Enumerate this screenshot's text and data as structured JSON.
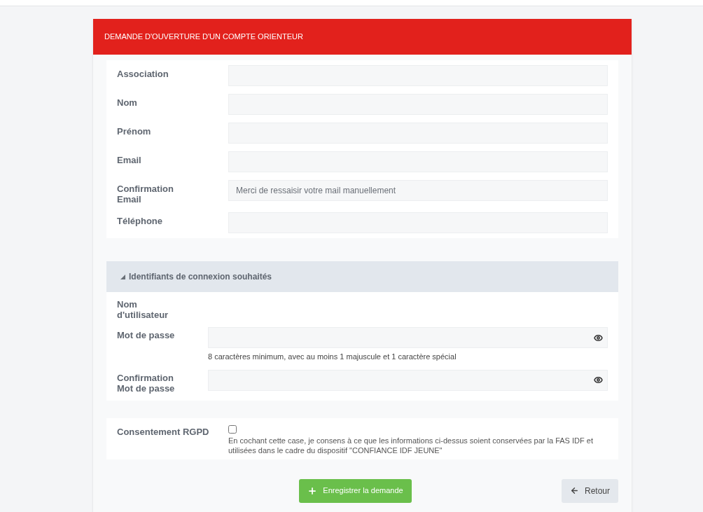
{
  "header": {
    "title": "DEMANDE D'OUVERTURE D'UN COMPTE ORIENTEUR"
  },
  "identity_fields": [
    {
      "label": "Association",
      "kind": "text"
    },
    {
      "label": "Nom",
      "kind": "text"
    },
    {
      "label": "Prénom",
      "kind": "text"
    },
    {
      "label": "Email",
      "kind": "text"
    },
    {
      "label": "Confirmation Email",
      "kind": "text",
      "placeholder": "Merci de ressaisir votre mail manuellement"
    },
    {
      "label": "Téléphone",
      "kind": "text"
    }
  ],
  "credentials": {
    "title": "Identifiants de connexion souhaités",
    "expanded": true,
    "fields": [
      {
        "label": "Nom d'utilisateur",
        "kind": "label"
      },
      {
        "label": "Mot de passe",
        "kind": "password",
        "hint": "8 caractères minimum, avec au moins 1 majuscule et 1 caractère spécial"
      },
      {
        "label": "Confirmation Mot de passe",
        "kind": "password"
      }
    ]
  },
  "consent": {
    "label": "Consentement RGPD",
    "checked": false,
    "text": "En cochant cette case, je consens à ce que les informations ci-dessus soient conservées par la FAS IDF et utilisées dans le cadre du dispositif \"CONFIANCE IDF JEUNE\""
  },
  "buttons": {
    "submit": "Enregistrer la demande",
    "back": "Retour"
  }
}
